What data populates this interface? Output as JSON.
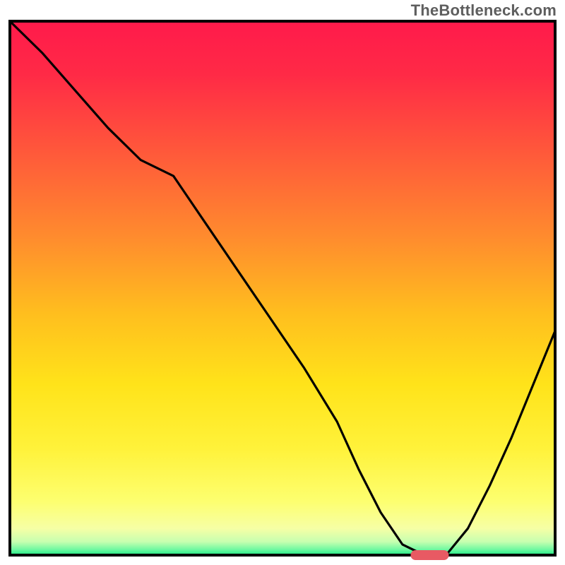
{
  "watermark": "TheBottleneck.com",
  "chart_data": {
    "type": "line",
    "title": "",
    "xlabel": "",
    "ylabel": "",
    "xlim": [
      0,
      100
    ],
    "ylim": [
      0,
      100
    ],
    "series": [
      {
        "name": "bottleneck-curve",
        "x": [
          0,
          6,
          12,
          18,
          24,
          30,
          36,
          42,
          48,
          54,
          60,
          64,
          68,
          72,
          76,
          80,
          84,
          88,
          92,
          96,
          100
        ],
        "values": [
          100,
          94,
          87,
          80,
          74,
          71,
          62,
          53,
          44,
          35,
          25,
          16,
          8,
          2,
          0,
          0,
          5,
          13,
          22,
          32,
          42
        ]
      }
    ],
    "marker": {
      "name": "optimal-band",
      "x_center": 77,
      "x_halfwidth": 3.5,
      "y": 0
    },
    "background": {
      "type": "vertical-gradient",
      "stops": [
        {
          "pos": 0.0,
          "color": "#ff1a4b"
        },
        {
          "pos": 0.1,
          "color": "#ff2a46"
        },
        {
          "pos": 0.25,
          "color": "#ff5a3a"
        },
        {
          "pos": 0.4,
          "color": "#ff8a2e"
        },
        {
          "pos": 0.55,
          "color": "#ffbf1e"
        },
        {
          "pos": 0.68,
          "color": "#ffe31a"
        },
        {
          "pos": 0.8,
          "color": "#fff23a"
        },
        {
          "pos": 0.9,
          "color": "#fdff70"
        },
        {
          "pos": 0.95,
          "color": "#f6ffa5"
        },
        {
          "pos": 0.975,
          "color": "#c7ffb0"
        },
        {
          "pos": 0.99,
          "color": "#6cf8a0"
        },
        {
          "pos": 1.0,
          "color": "#1ee884"
        }
      ]
    }
  }
}
